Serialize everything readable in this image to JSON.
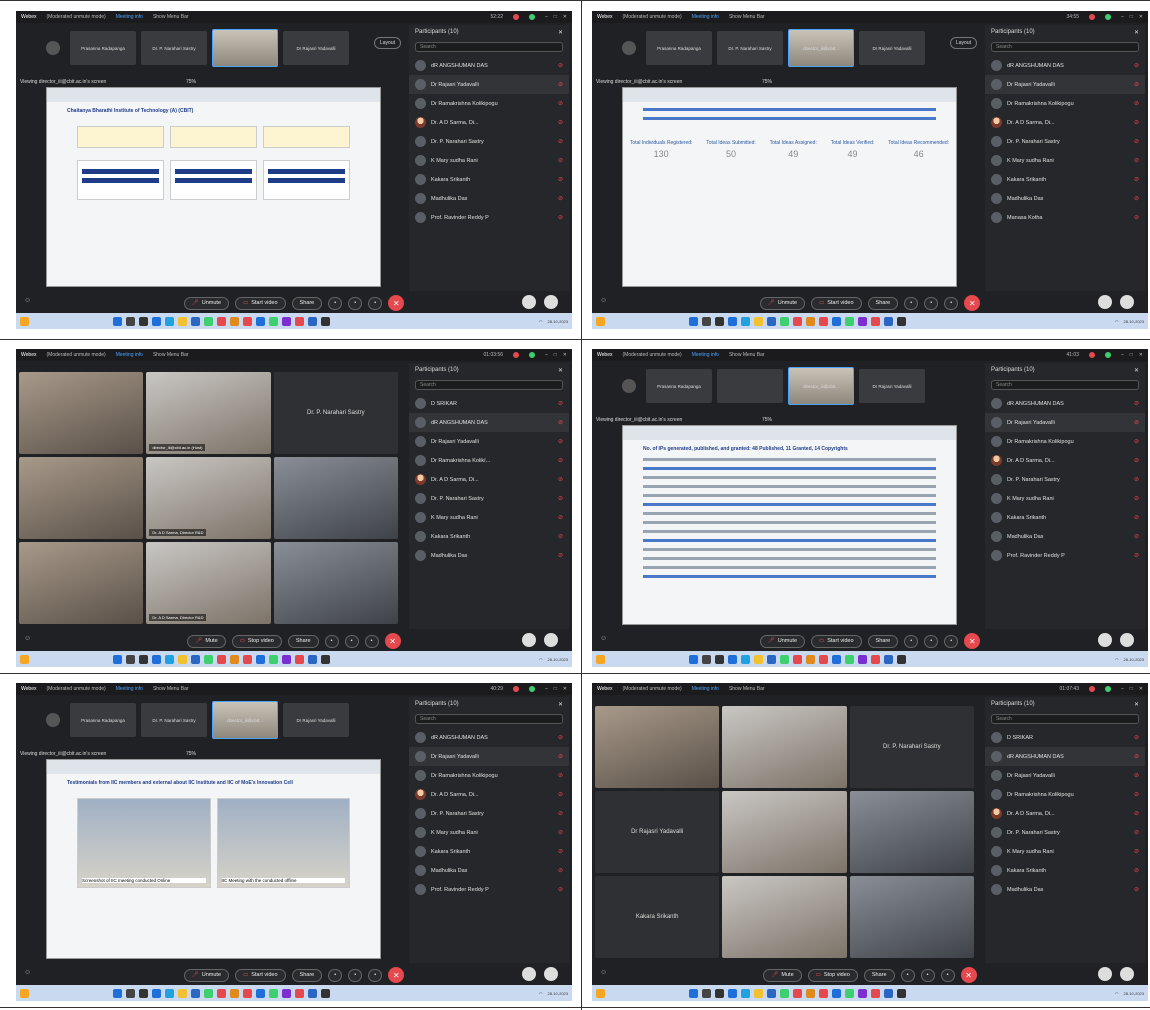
{
  "app": {
    "name": "Webex",
    "mode": "(Moderated unmute mode)",
    "meeting_info": "Meeting info",
    "menu_bar": "Show Menu Bar"
  },
  "screens": [
    {
      "clock": "52:22",
      "view": "share",
      "thumbs": [
        "Prasanna Radapanga",
        "Dr. P. Narahari Sastry",
        "",
        "Dr Rajasri Yadavalli"
      ],
      "viewing": "Viewing director_iii@cbit.ac.in's screen",
      "zoom": "75%",
      "layout": "Layout",
      "doc_title": "Chaitanya Bharathi Institute of Technology (A) (CBIT)",
      "stats": null,
      "participants_header": "Participants (10)",
      "search": "Search",
      "participants": [
        "dR ANGSHUMAN DAS",
        "Dr Rajasri Yadavalli",
        "Dr Ramakrishna Kolikipogu",
        "Dr. A D Sarma, Di...",
        "Dr. P. Narahari Sastry",
        "K Mary sudha Rani",
        "Kakara Srikanth",
        "Madhulika Das",
        "Prof. Ravinder Reddy P"
      ],
      "controls": [
        "Unmute",
        "Start video",
        "Share"
      ],
      "date": "28-10-2023"
    },
    {
      "clock": "34:55",
      "view": "share",
      "thumbs": [
        "Prasanna Radapanga",
        "Dr. P. Narahari Sastry",
        "director_iii@cbit...",
        "Dr Rajasri Yadavalli"
      ],
      "viewing": "Viewing director_iii@cbit.ac.in's screen",
      "zoom": "75%",
      "layout": "Layout",
      "doc_title": "",
      "stats": {
        "labels": [
          "Total Individuals Registered:",
          "Total Ideas Submitted:",
          "Total Ideas Assigned:",
          "Total Ideas Verified:",
          "Total Ideas Recommended:"
        ],
        "values": [
          "130",
          "50",
          "49",
          "49",
          "46"
        ]
      },
      "participants_header": "Participants (10)",
      "search": "Search",
      "participants": [
        "dR ANGSHUMAN DAS",
        "Dr Rajasri Yadavalli",
        "Dr Ramakrishna Kolikipogu",
        "Dr. A D Sarma, Di...",
        "Dr. P. Narahari Sastry",
        "K Mary sudha Rani",
        "Kakara Srikanth",
        "Madhulika Das",
        "Manasa Kotha"
      ],
      "controls": [
        "Unmute",
        "Start video",
        "Share"
      ],
      "date": "28-10-2023"
    },
    {
      "clock": "01:03:56",
      "view": "gallery",
      "tiles": [
        "",
        "director_iii@cbit.ac.in (Host)",
        "Dr. P. Narahari Sastry",
        "",
        "Dr. A D Sarma, Director R&D",
        "",
        "",
        "Dr. A D Sarma, Director R&D",
        ""
      ],
      "participants_header": "Participants (10)",
      "search": "Search",
      "participants": [
        "D SRIKAR",
        "dR ANGSHUMAN DAS",
        "Dr Rajasri Yadavalli",
        "Dr Ramakrishna Kolikí...",
        "Dr. A D Sarma, Di...",
        "Dr. P. Narahari Sastry",
        "K Mary sudha Rani",
        "Kakara Srikanth",
        "Madhulika Das"
      ],
      "controls": [
        "Mute",
        "Stop video",
        "Share"
      ],
      "date": "28-10-2023"
    },
    {
      "clock": "41:03",
      "view": "share",
      "thumbs": [
        "Prasanna Radapanga",
        "",
        "director_iii@cbit...",
        "Dr Rajasri Yadavalli"
      ],
      "viewing": "Viewing director_iii@cbit.ac.in's screen",
      "zoom": "75%",
      "layout": "",
      "doc_title": "No. of IPs generated, published, and granted: 48 Published, 11 Granted, 14 Copyrights",
      "stats": null,
      "participants_header": "Participants (10)",
      "search": "Search",
      "participants": [
        "dR ANGSHUMAN DAS",
        "Dr Rajasri Yadavalli",
        "Dr Ramakrishna Kolikipogu",
        "Dr. A D Sarma, Di...",
        "Dr. P. Narahari Sastry",
        "K Mary sudha Rani",
        "Kakara Srikanth",
        "Madhulika Das",
        "Prof. Ravinder Reddy P"
      ],
      "controls": [
        "Unmute",
        "Start video",
        "Share"
      ],
      "date": "28-10-2023"
    },
    {
      "clock": "40:29",
      "view": "share",
      "thumbs": [
        "Prasanna Radapanga",
        "Dr. P. Narahari Sastry",
        "director_iii@cbit...",
        "Dr Rajasri Yadavalli"
      ],
      "viewing": "Viewing director_iii@cbit.ac.in's screen",
      "zoom": "75%",
      "layout": "",
      "doc_title": "Testimonials from IIC members and external about IIC Institute and IIC of MoE's Innovation Cell",
      "captions": [
        "Screenshot of IIC meeting conducted Online",
        "IIC Meeting with the conducted offline"
      ],
      "stats": null,
      "participants_header": "Participants (10)",
      "search": "Search",
      "participants": [
        "dR ANGSHUMAN DAS",
        "Dr Rajasri Yadavalli",
        "Dr Ramakrishna Kolikipogu",
        "Dr. A D Sarma, Di...",
        "Dr. P. Narahari Sastry",
        "K Mary sudha Rani",
        "Kakara Srikanth",
        "Madhulika Das",
        "Prof. Ravinder Reddy P"
      ],
      "controls": [
        "Unmute",
        "Start video",
        "Share"
      ],
      "date": "28-10-2023"
    },
    {
      "clock": "01:07:43",
      "view": "gallery",
      "tiles": [
        "",
        "",
        "Dr. P. Narahari Sastry",
        "Dr Rajasri Yadavalli",
        "",
        "",
        "Kakara Srikanth",
        "",
        ""
      ],
      "participants_header": "Participants (10)",
      "search": "Search",
      "participants": [
        "D SRIKAR",
        "dR ANGSHUMAN DAS",
        "Dr Rajasri Yadavalli",
        "Dr Ramakrishna Kolikipogu",
        "Dr. A D Sarma, Di...",
        "Dr. P. Narahari Sastry",
        "K Mary sudha Rani",
        "Kakara Srikanth",
        "Madhulika Das"
      ],
      "controls": [
        "Mute",
        "Stop video",
        "Share"
      ],
      "date": "28-10-2023"
    }
  ],
  "colors": {
    "accent": "#4aa3ff",
    "end_call": "#e5484d",
    "taskbar": "#c9daf0",
    "panel": "#26272a"
  }
}
